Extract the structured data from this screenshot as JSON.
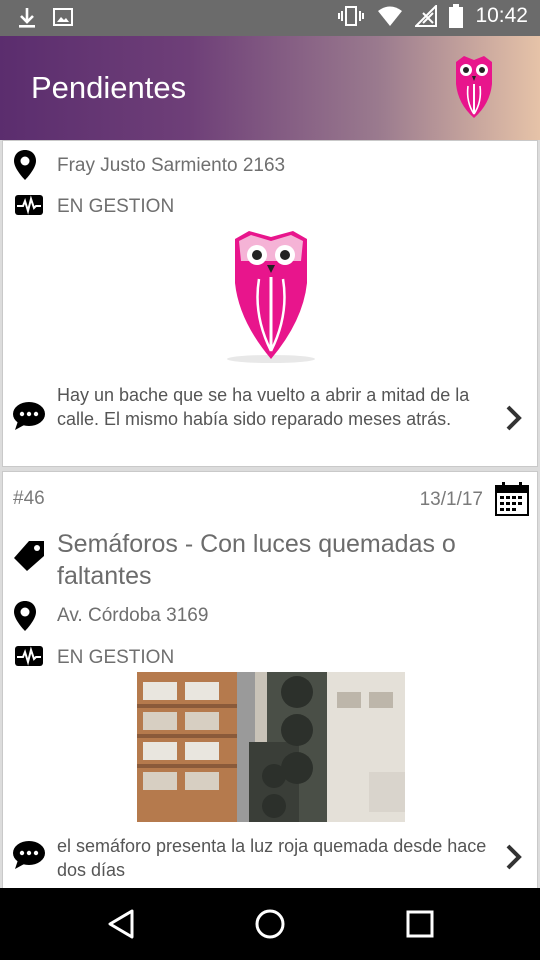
{
  "status_bar": {
    "time": "10:42",
    "left_icons": [
      "download-icon",
      "image-icon"
    ],
    "right_icons": [
      "vibrate-icon",
      "wifi-icon",
      "no-signal-icon",
      "battery-icon"
    ]
  },
  "app_bar": {
    "title": "Pendientes",
    "logo": "owl-logo-icon"
  },
  "colors": {
    "brand_pink": "#e8158c",
    "appbar_start": "#5b2d6e",
    "appbar_end": "#e6c3a8"
  },
  "cards": [
    {
      "address": "Fray Justo Sarmiento 2163",
      "status": "EN GESTION",
      "image": "owl-logo-placeholder",
      "description": "Hay un bache que se ha vuelto a abrir a mitad de la calle. El mismo había sido reparado meses atrás."
    },
    {
      "number": "#46",
      "date": "13/1/17",
      "category": "Semáforos - Con luces quemadas o faltantes",
      "address": "Av. Córdoba 3169",
      "status": "EN GESTION",
      "image": "traffic-light-photo",
      "description": "el semáforo presenta la luz roja quemada desde hace dos días"
    }
  ],
  "nav_bar": [
    "back-icon",
    "home-icon",
    "recents-icon"
  ]
}
